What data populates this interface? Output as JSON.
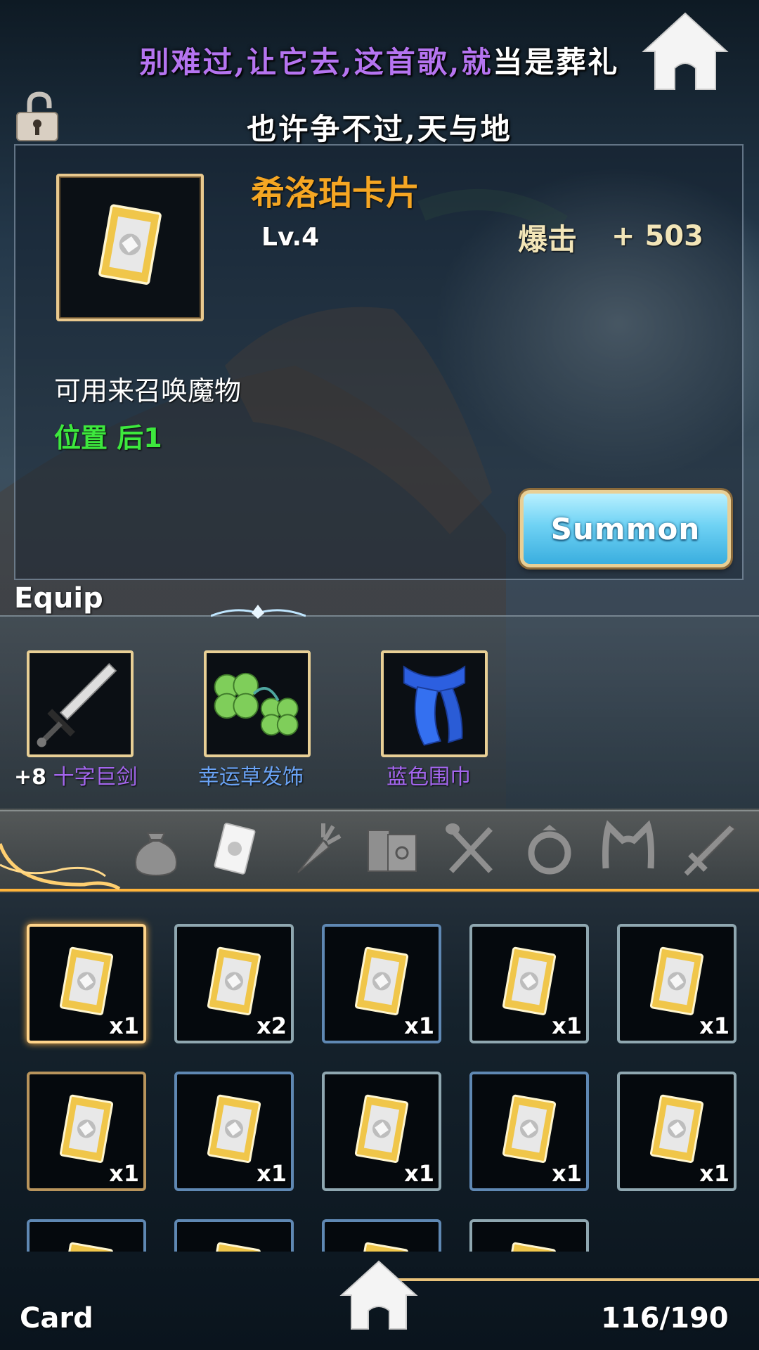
{
  "lyrics": {
    "line1_sung": "别难过,让它去,这首歌,就",
    "line1_unsung": "当是葬礼",
    "line2": "也许争不过,天与地"
  },
  "item": {
    "name": "希洛珀卡片",
    "level": "Lv.4",
    "stat_label": "爆击",
    "stat_value": "+ 503",
    "description": "可用来召唤魔物",
    "position": "位置 后1",
    "icon": "card-icon"
  },
  "summon_button": "Summon",
  "equip": {
    "title": "Equip",
    "items": [
      {
        "icon": "sword-icon",
        "plus": "+8",
        "name": "十字巨剑"
      },
      {
        "icon": "clover-hair-accessory-icon",
        "name": "幸运草发饰"
      },
      {
        "icon": "blue-scarf-icon",
        "name": "蓝色围巾"
      }
    ]
  },
  "tabs": [
    {
      "icon": "bag-icon"
    },
    {
      "icon": "card-icon",
      "active": true
    },
    {
      "icon": "carrot-icon"
    },
    {
      "icon": "books-icon"
    },
    {
      "icon": "utensils-icon"
    },
    {
      "icon": "ring-icon"
    },
    {
      "icon": "cat-ears-icon"
    },
    {
      "icon": "sword-icon"
    }
  ],
  "inventory": [
    {
      "count": "x1",
      "frame": "selected"
    },
    {
      "count": "x2",
      "frame": "silver"
    },
    {
      "count": "x1",
      "frame": "blue"
    },
    {
      "count": "x1",
      "frame": "silver"
    },
    {
      "count": "x1",
      "frame": "silver"
    },
    {
      "count": "x1",
      "frame": "gold"
    },
    {
      "count": "x1",
      "frame": "blue"
    },
    {
      "count": "x1",
      "frame": "silver"
    },
    {
      "count": "x1",
      "frame": "blue"
    },
    {
      "count": "x1",
      "frame": "silver"
    },
    {
      "count": "",
      "frame": "blue"
    },
    {
      "count": "",
      "frame": "blue"
    },
    {
      "count": "",
      "frame": "blue"
    },
    {
      "count": "",
      "frame": "silver"
    }
  ],
  "footer": {
    "category": "Card",
    "capacity": "116/190"
  },
  "colors": {
    "item_name": "#f5a623",
    "position_text": "#3de83d",
    "lyric_sung": "#b574f0",
    "equip_purple": "#a466ee",
    "equip_blue": "#6aa3f5"
  }
}
